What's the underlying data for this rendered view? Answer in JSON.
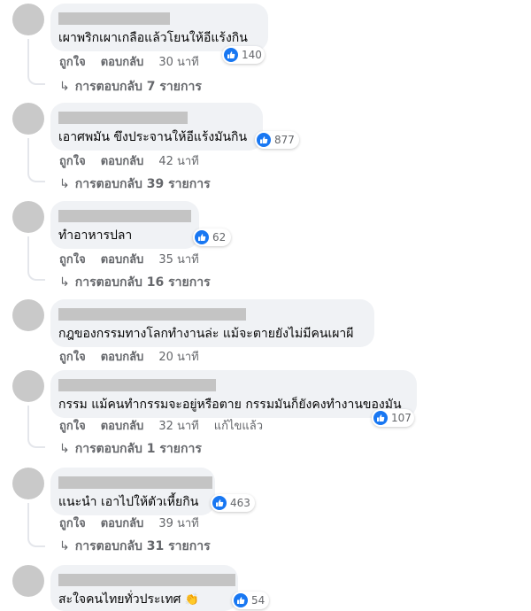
{
  "comments": [
    {
      "text": "เผาพริกเผาเกลือแล้วโยนให้อีแร้งกิน",
      "likes": "140",
      "like_label": "ถูกใจ",
      "reply_label": "ตอบกลับ",
      "time": "30 นาที",
      "edited": "",
      "replies": "การตอบกลับ 7 รายการ"
    },
    {
      "text": "เอาศพมัน ขึงประจานให้อีแร้งมันกิน",
      "likes": "877",
      "like_label": "ถูกใจ",
      "reply_label": "ตอบกลับ",
      "time": "42 นาที",
      "edited": "",
      "replies": "การตอบกลับ 39 รายการ"
    },
    {
      "text": "ทำอาหารปลา",
      "likes": "62",
      "like_label": "ถูกใจ",
      "reply_label": "ตอบกลับ",
      "time": "35 นาที",
      "edited": "",
      "replies": "การตอบกลับ 16 รายการ"
    },
    {
      "text": "กฎของกรรมทางโลกทำงานล่ะ แม้จะตายยังไม่มีคนเผาผี",
      "likes": "",
      "like_label": "ถูกใจ",
      "reply_label": "ตอบกลับ",
      "time": "20 นาที",
      "edited": "",
      "replies": ""
    },
    {
      "text": "กรรม แม้คนทำกรรมจะอยู่หรือตาย กรรมมันก็ยังคงทำงานของมัน",
      "likes": "107",
      "like_label": "ถูกใจ",
      "reply_label": "ตอบกลับ",
      "time": "32 นาที",
      "edited": "แก้ไขแล้ว",
      "replies": "การตอบกลับ 1 รายการ"
    },
    {
      "text": "แนะนำ เอาไปให้ตัวเหี้ยกิน",
      "likes": "463",
      "like_label": "ถูกใจ",
      "reply_label": "ตอบกลับ",
      "time": "39 นาที",
      "edited": "",
      "replies": "การตอบกลับ 31 รายการ"
    },
    {
      "text": "สะใจคนไทยทั่วประเทศ",
      "likes": "54",
      "like_label": "",
      "reply_label": "",
      "time": "",
      "edited": "",
      "replies": ""
    }
  ],
  "icons": {
    "reaction": "like-icon",
    "reply": "reply-arrow-icon",
    "emoji": "clapping-hands-icon"
  },
  "colors": {
    "like_blue": "#1877f2",
    "bubble": "#f0f2f5",
    "meta_text": "#65676b"
  }
}
